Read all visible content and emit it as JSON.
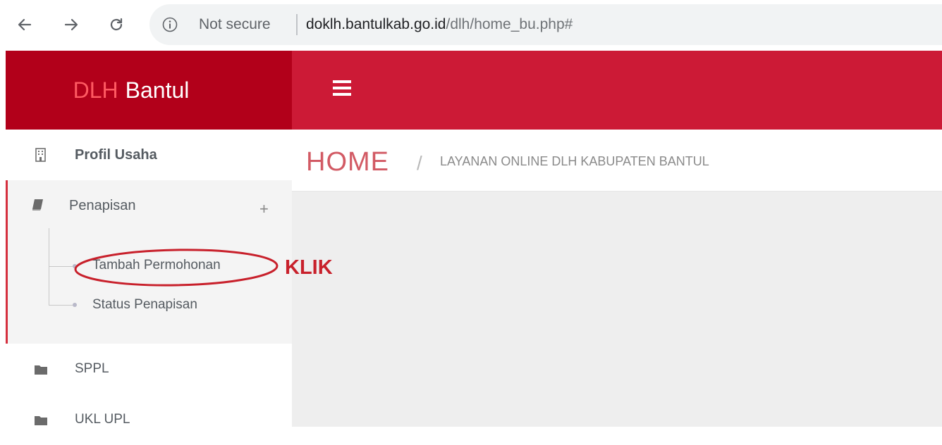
{
  "browser": {
    "security_label": "Not secure",
    "url_host": "doklh.bantulkab.go.id",
    "url_path": "/dlh/home_bu.php#"
  },
  "brand": {
    "part1": "DLH",
    "part2": "Bantul"
  },
  "sidebar": {
    "items": [
      {
        "label": "Profil Usaha",
        "icon": "building-icon"
      },
      {
        "label": "Penapisan",
        "icon": "book-icon"
      },
      {
        "label": "SPPL",
        "icon": "folder-icon"
      },
      {
        "label": "UKL UPL",
        "icon": "folder-icon"
      }
    ],
    "penapisan_sub": [
      {
        "label": "Tambah Permohonan"
      },
      {
        "label": "Status Penapisan"
      }
    ],
    "expand_symbol": "+"
  },
  "breadcrumb": {
    "home": "HOME",
    "separator": "/",
    "current": "LAYANAN ONLINE DLH KABUPATEN BANTUL"
  },
  "annotation": {
    "text": "KLIK"
  },
  "colors": {
    "brand_bg": "#b2001a",
    "topbar_bg": "#cc1a36",
    "accent": "#d25a64",
    "annotation": "#c8202b"
  }
}
